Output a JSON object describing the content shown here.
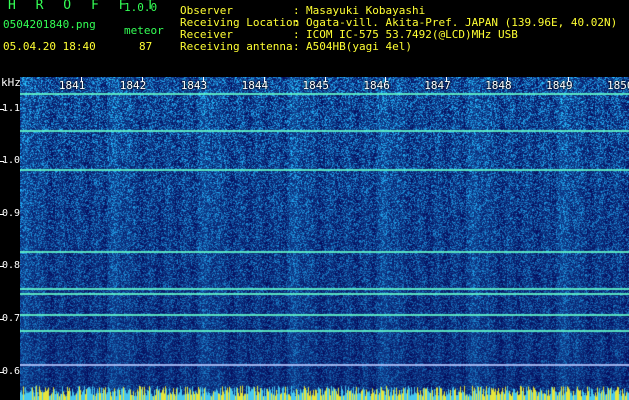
{
  "header": {
    "app_title": "H R O F F T",
    "app_version": "1.0.0",
    "file_name": "0504201840.png",
    "meteor_label": "meteor",
    "timestamp": "05.04.20 18:40",
    "meteor_count": "87"
  },
  "metadata": [
    {
      "key": "Observer",
      "value": "Masayuki Kobayashi"
    },
    {
      "key": "Receiving Location",
      "value": "Ogata-vill. Akita-Pref. JAPAN (139.96E, 40.02N)"
    },
    {
      "key": "Receiver",
      "value": "ICOM IC-575 53.7492(@LCD)MHz USB"
    },
    {
      "key": "Receiving antenna",
      "value": "A504HB(yagi 4el)"
    }
  ],
  "separator": ":",
  "colors": {
    "header_green": "#33ff55",
    "header_yellow": "#ffff33",
    "spectrogram_bg": "#050a6e",
    "signal_line": "#66ffcc"
  },
  "chart_data": {
    "type": "heatmap",
    "ylabel": "kHz",
    "y_ticks": [
      "1.1",
      "1.0",
      "0.9",
      "0.8",
      "0.7",
      "0.6"
    ],
    "x_ticks": [
      "1841",
      "1842",
      "1843",
      "1844",
      "1845",
      "1846",
      "1847",
      "1848",
      "1849",
      "1850"
    ],
    "x_range": [
      1840,
      1850
    ],
    "y_range": [
      0.59,
      1.16
    ],
    "horizontal_signals_khz": [
      1.13,
      1.06,
      0.985,
      0.83,
      0.76,
      0.75,
      0.71,
      0.68,
      0.615
    ]
  }
}
